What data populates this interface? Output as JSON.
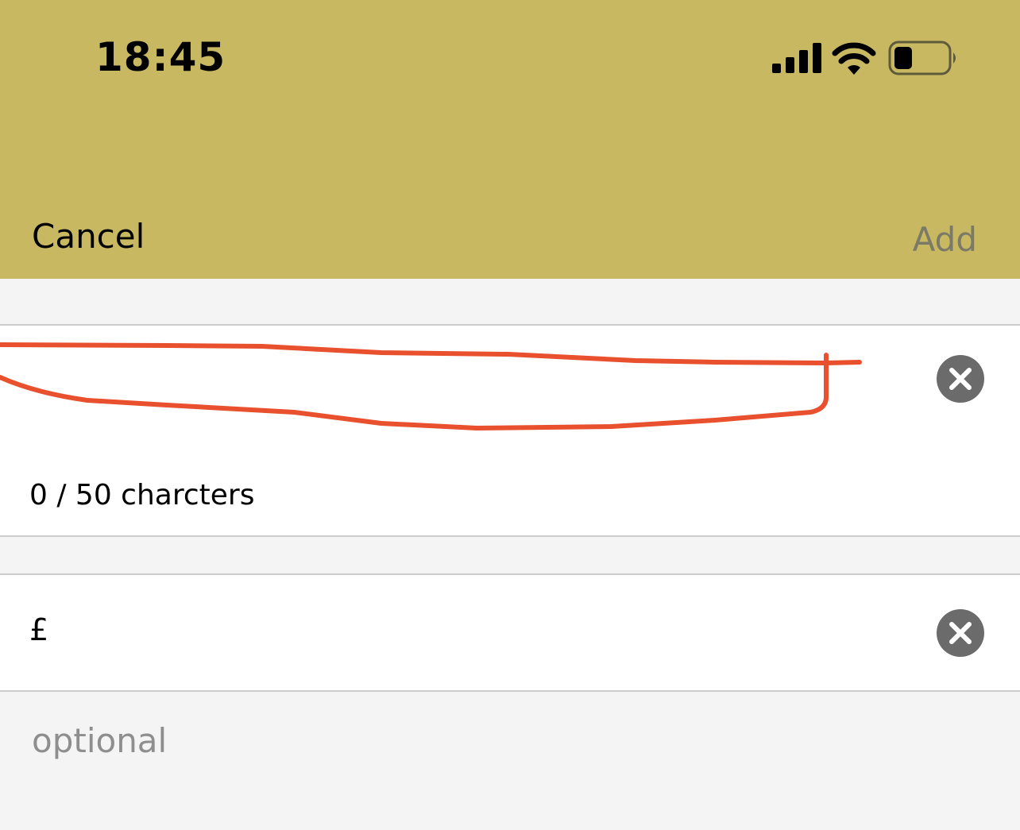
{
  "status_bar": {
    "time": "18:45",
    "icons": [
      "cellular-signal-icon",
      "wifi-icon",
      "battery-icon"
    ]
  },
  "nav": {
    "cancel_label": "Cancel",
    "add_label": "Add"
  },
  "form": {
    "name_field": {
      "value_redacted": true,
      "counter": "0 / 50 charcters",
      "clear_icon": "clear-icon"
    },
    "price_field": {
      "currency_symbol": "£",
      "clear_icon": "clear-icon"
    },
    "footer_note": "optional"
  },
  "colors": {
    "header_background": "#c9b862",
    "page_background": "#f4f4f4",
    "field_background": "#ffffff",
    "redaction_stroke": "#e8502e",
    "disabled_action": "#7a7a66",
    "clear_button": "#6b6b6b"
  }
}
